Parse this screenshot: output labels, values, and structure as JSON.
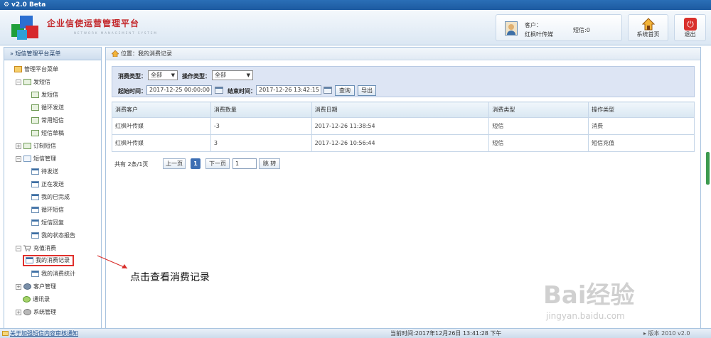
{
  "window": {
    "title": "v2.0 Beta"
  },
  "header": {
    "app_title": "企业信使运营管理平台",
    "app_subtitle": "NETWORK MANAGEMENT SYSTEM",
    "customer_label": "客户：",
    "customer_name": "红枫叶传媒",
    "sms_label": "短信:0",
    "home_label": "系统首页",
    "exit_label": "退出"
  },
  "sidebar": {
    "title": "» 短信管理平台菜单",
    "nodes": {
      "root": "管理平台菜单",
      "send_sms": "发短信",
      "send_sms_item": "发短信",
      "loop_send": "循环发送",
      "common_sms": "常用短信",
      "drafts": "短信草稿",
      "custom_sms": "订制短信",
      "sms_manage": "短信管理",
      "pending": "待发送",
      "sending": "正在发送",
      "completed": "我的已完成",
      "loop_sms": "循环短信",
      "reply": "短信回复",
      "status_report": "我的状态报告",
      "recharge": "充值消费",
      "my_records": "我的消费记录",
      "my_stats": "我的消费统计",
      "customer_mgmt": "客户管理",
      "contacts": "通讯录",
      "system_mgmt": "系统管理"
    }
  },
  "breadcrumb": {
    "text": "位置：我的消费记录"
  },
  "filter": {
    "consume_type_label": "消费类型：",
    "consume_type_value": "全部",
    "op_type_label": "操作类型：",
    "op_type_value": "全部",
    "start_label": "起始时间：",
    "start_value": "2017-12-25 00:00:00",
    "end_label": "结束时间：",
    "end_value": "2017-12-26 13:42:15",
    "query_button": "查询",
    "export_button": "导出"
  },
  "table": {
    "headers": [
      "消费客户",
      "消费数量",
      "消费日期",
      "消费类型",
      "操作类型"
    ],
    "rows": [
      [
        "红枫叶传媒",
        "-3",
        "2017-12-26 11:38:54",
        "短信",
        "消费"
      ],
      [
        "红枫叶传媒",
        "3",
        "2017-12-26 10:56:44",
        "短信",
        "短信充值"
      ]
    ]
  },
  "pager": {
    "summary": "共有 2条/1页",
    "prev": "上一页",
    "current": "1",
    "next": "下一页",
    "input_value": "1",
    "jump": "跳 转"
  },
  "annotation": {
    "text": "点击查看消费记录"
  },
  "watermark": {
    "main": "Bai经验",
    "sub": "jingyan.baidu.com"
  },
  "status": {
    "notice": "关于加强短信内容审核通知",
    "time": "当前时间:2017年12月26日 13:41:28 下午",
    "version": "▸ 版本 2010  v2.0"
  },
  "colors": {
    "accent": "#3d6fb3",
    "title_red": "#c3262a",
    "highlight": "#e0302c"
  }
}
